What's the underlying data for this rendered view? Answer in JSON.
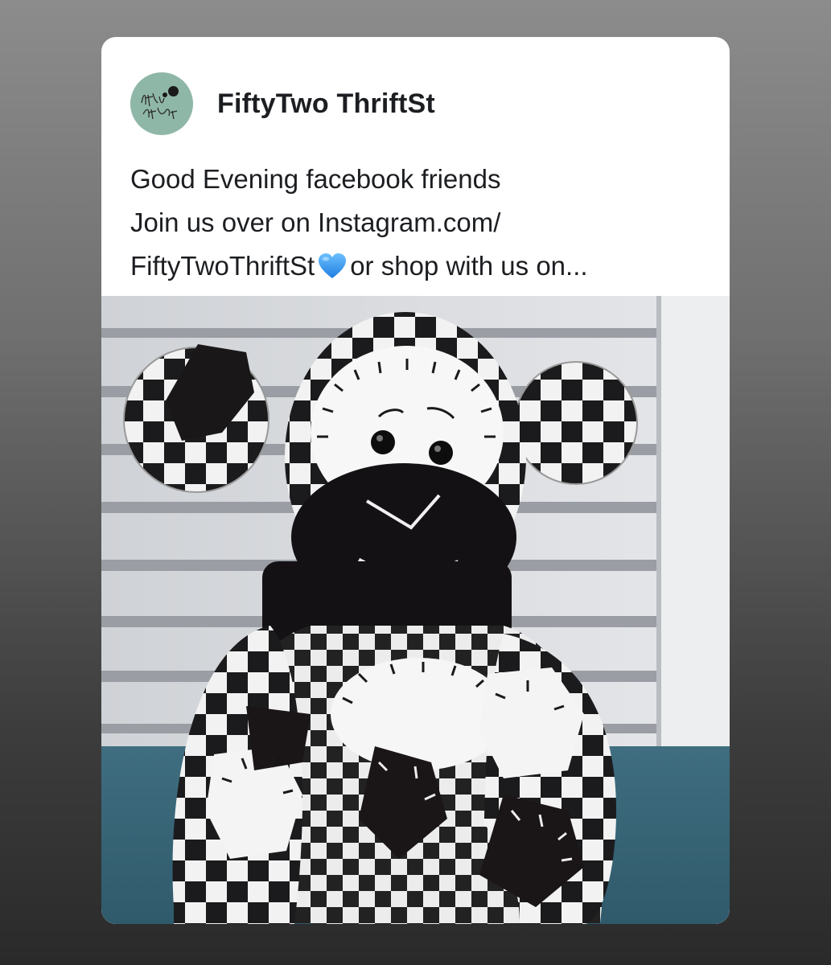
{
  "post": {
    "page_name": "FiftyTwo ThriftSt",
    "text_line_1": "Good Evening facebook friends",
    "text_line_2": "Join us over on Instagram.com/",
    "text_line_3_start": "FiftyTwoThriftSt",
    "heart_icon": "blue-heart-emoji",
    "text_line_3_end": "or shop with us on..."
  },
  "colors": {
    "avatar_bg": "#8fb7a8",
    "heart": "#3b9cf2",
    "card_bg": "#ffffff",
    "text": "#1c1e21"
  }
}
